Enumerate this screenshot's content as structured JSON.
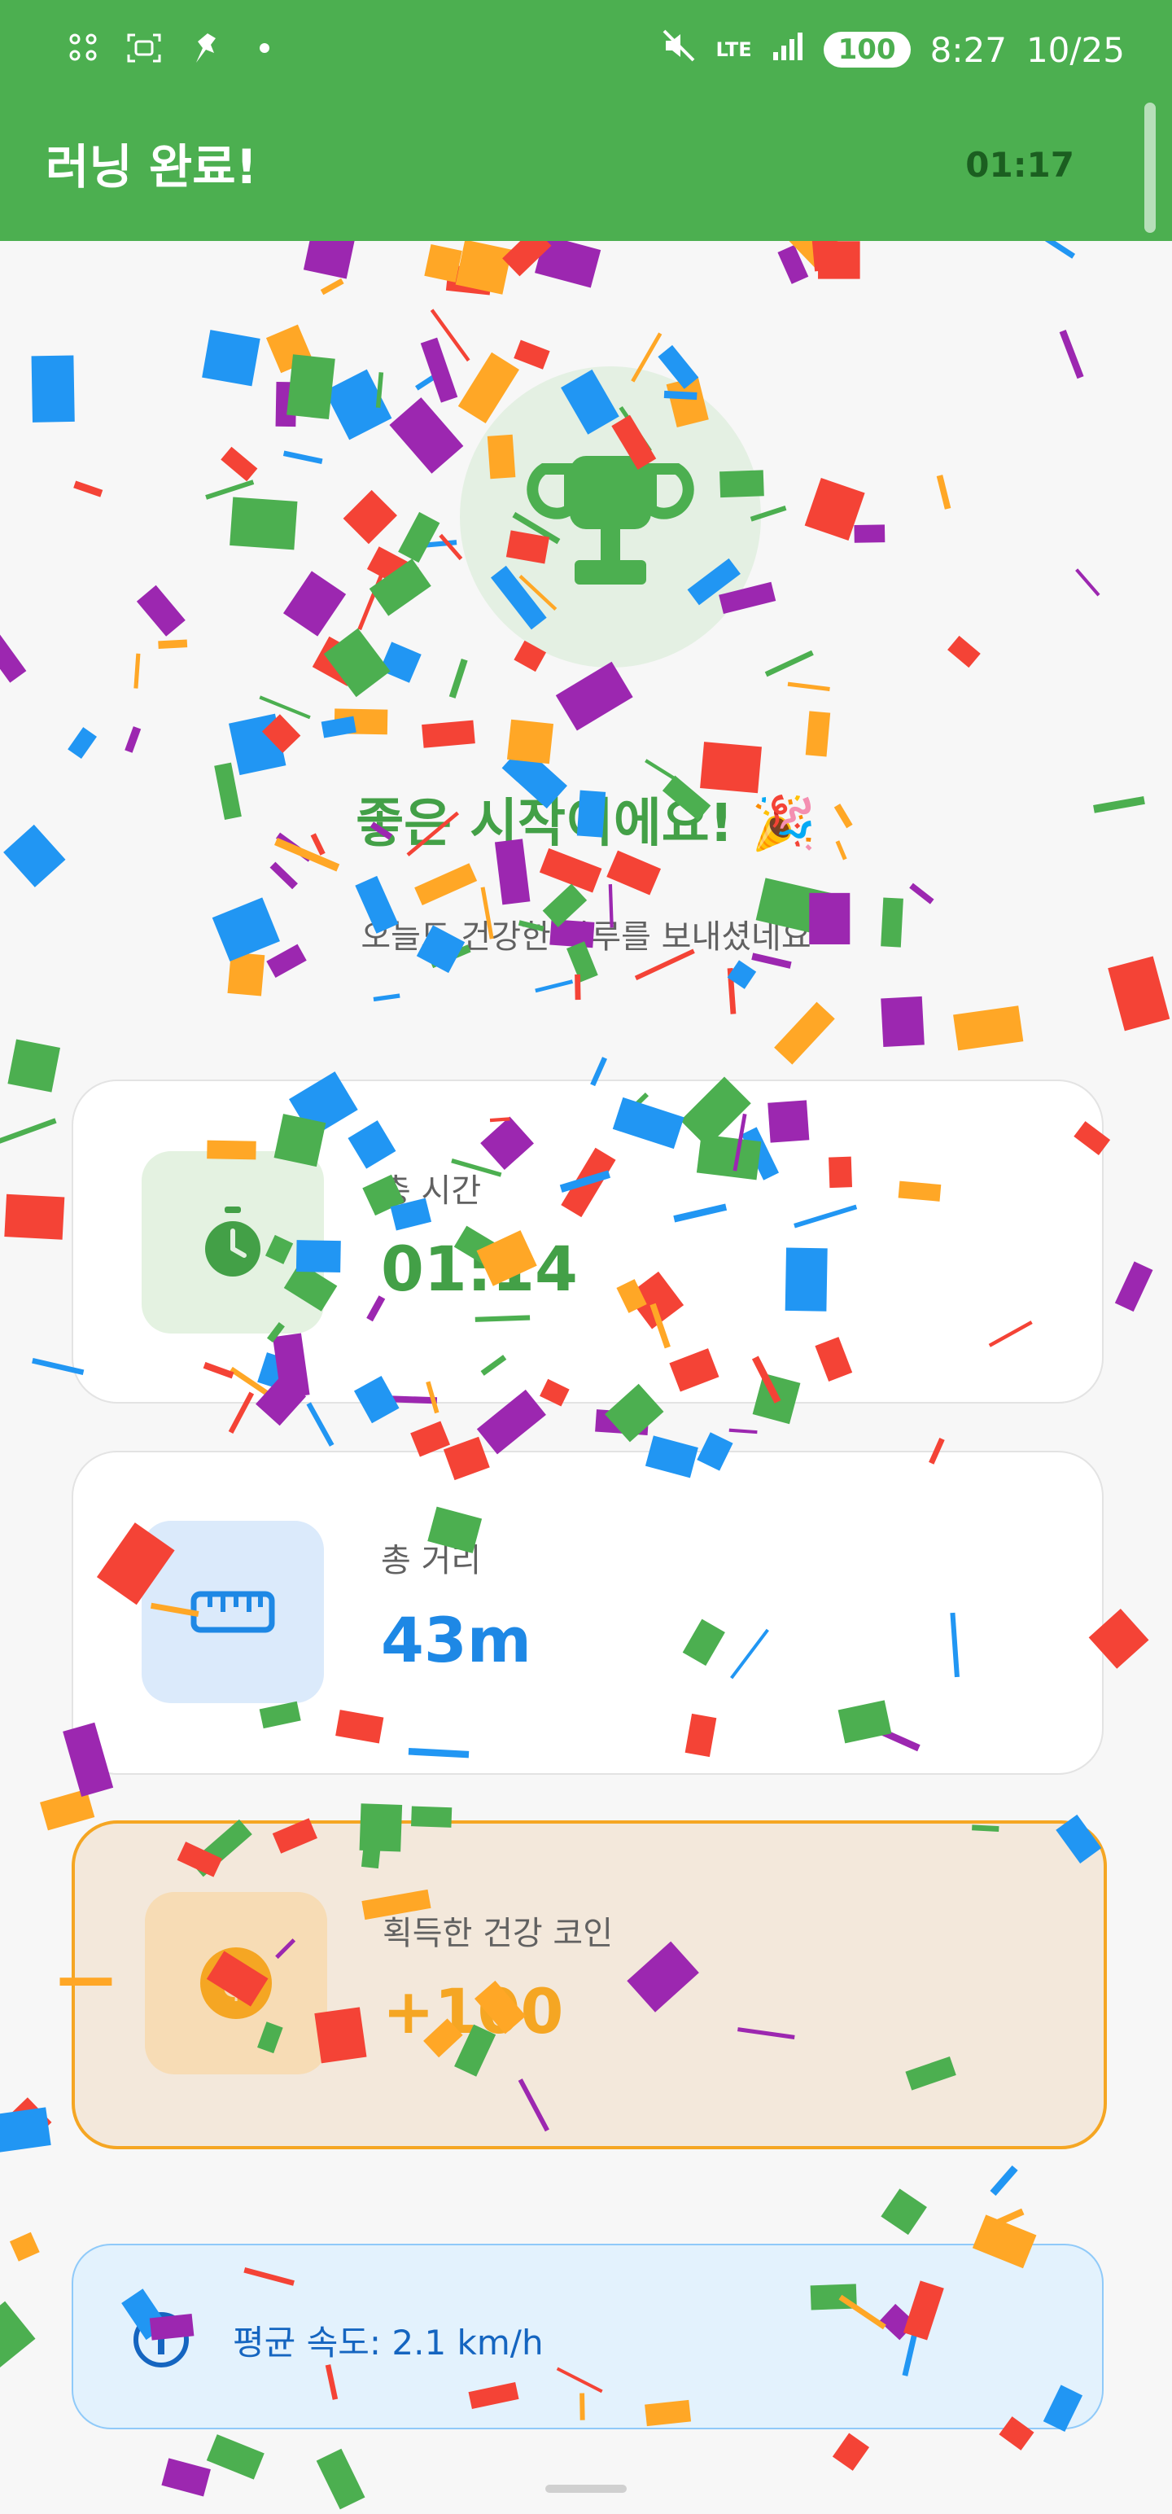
{
  "status_bar": {
    "time": "8:27",
    "date": "10/25",
    "battery": "100",
    "network": "LTE"
  },
  "app_bar": {
    "title": "러닝 완료!",
    "timer": "01:17"
  },
  "hero": {
    "headline": "좋은 시작이에요! 🎉",
    "subline": "오늘도 건강한 하루를 보내셨네요"
  },
  "cards": {
    "time": {
      "label": "총 시간",
      "value": "01:14",
      "color": "#43a047",
      "bg": "#e4f2e1",
      "icon": "stopwatch-icon"
    },
    "distance": {
      "label": "총 거리",
      "value": "43m",
      "color": "#1e88e5",
      "bg": "#dbeafb",
      "icon": "ruler-icon"
    },
    "coins": {
      "label": "획득한 건강 코인",
      "value": "+100",
      "color": "#f5a623",
      "bg": "#f7dcb5",
      "border": "#f5a623",
      "icon": "dollar-coin-icon"
    }
  },
  "info": {
    "text": "평균 속도: 2.1 km/h"
  },
  "colors": {
    "primary": "#4caf50",
    "confetti": [
      "#f44336",
      "#2196f3",
      "#4caf50",
      "#9c27b0",
      "#ffa726"
    ]
  }
}
